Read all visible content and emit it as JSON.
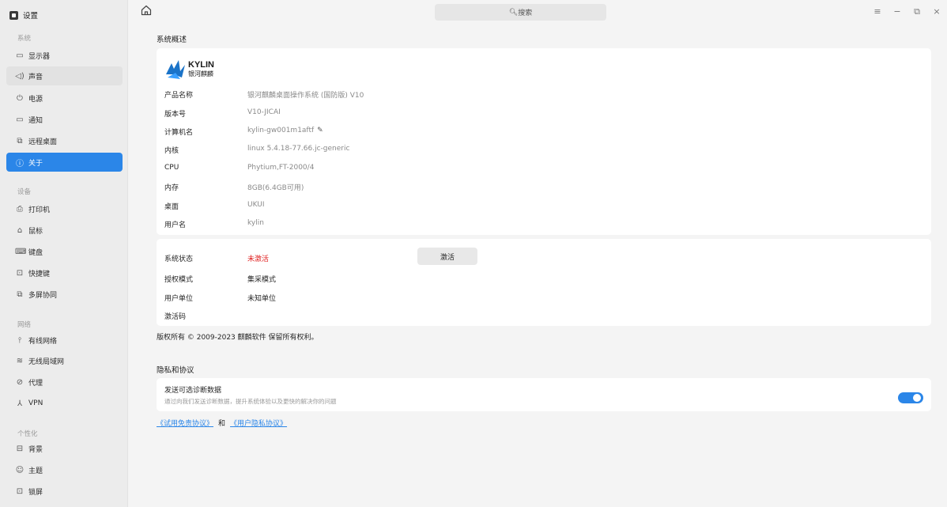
{
  "app": {
    "title": "设置"
  },
  "sidebar": {
    "groups": [
      {
        "title": "系统",
        "items": [
          {
            "label": "显示器",
            "icon": "monitor-icon"
          },
          {
            "label": "声音",
            "icon": "sound-icon"
          },
          {
            "label": "电源",
            "icon": "power-icon"
          },
          {
            "label": "通知",
            "icon": "notification-icon"
          },
          {
            "label": "远程桌面",
            "icon": "remote-desktop-icon"
          },
          {
            "label": "关于",
            "icon": "info-icon"
          }
        ]
      },
      {
        "title": "设备",
        "items": [
          {
            "label": "打印机",
            "icon": "printer-icon"
          },
          {
            "label": "鼠标",
            "icon": "mouse-icon"
          },
          {
            "label": "键盘",
            "icon": "keyboard-icon"
          },
          {
            "label": "快捷键",
            "icon": "shortcut-icon"
          },
          {
            "label": "多屏协同",
            "icon": "multiscreen-icon"
          }
        ]
      },
      {
        "title": "网络",
        "items": [
          {
            "label": "有线网络",
            "icon": "wired-network-icon"
          },
          {
            "label": "无线局域网",
            "icon": "wifi-icon"
          },
          {
            "label": "代理",
            "icon": "proxy-icon"
          },
          {
            "label": "VPN",
            "icon": "vpn-icon"
          }
        ]
      },
      {
        "title": "个性化",
        "items": [
          {
            "label": "背景",
            "icon": "background-icon"
          },
          {
            "label": "主题",
            "icon": "theme-icon"
          },
          {
            "label": "锁屏",
            "icon": "lock-screen-icon"
          }
        ]
      }
    ]
  },
  "topbar": {
    "search_placeholder": "搜索"
  },
  "overview": {
    "title": "系统概述",
    "logo_text": "KYLIN",
    "logo_subtext": "银河麒麟",
    "rows": [
      {
        "label": "产品名称",
        "value": "银河麒麟桌面操作系统 (国防版) V10"
      },
      {
        "label": "版本号",
        "value": "V10-JICAI"
      },
      {
        "label": "计算机名",
        "value": "kylin-gw001m1aftf"
      },
      {
        "label": "内核",
        "value": "linux 5.4.18-77.66.jc-generic"
      },
      {
        "label": "CPU",
        "value": "Phytium,FT-2000/4"
      },
      {
        "label": "内存",
        "value": "8GB(6.4GB可用)"
      },
      {
        "label": "桌面",
        "value": "UKUI"
      },
      {
        "label": "用户名",
        "value": "kylin"
      }
    ]
  },
  "activation": {
    "rows": [
      {
        "label": "系统状态",
        "value": "未激活"
      },
      {
        "label": "授权模式",
        "value": "集采模式"
      },
      {
        "label": "用户单位",
        "value": "未知单位"
      },
      {
        "label": "激活码",
        "value": ""
      }
    ],
    "button_label": "激活",
    "status_color": "#e02020"
  },
  "copyright": "版权所有 © 2009-2023 麒麟软件 保留所有权利。",
  "privacy": {
    "title": "隐私和协议",
    "option_title": "发送可选诊断数据",
    "option_desc": "通过向我们发送诊断数据，提升系统体验以及更快的解决你的问题",
    "toggle_on": true,
    "link1": "《试用免责协议》",
    "and": "和",
    "link2": "《用户隐私协议》"
  },
  "colors": {
    "accent": "#2b86e8",
    "sidebar_bg": "#ececec",
    "main_bg": "#f4f4f4"
  }
}
